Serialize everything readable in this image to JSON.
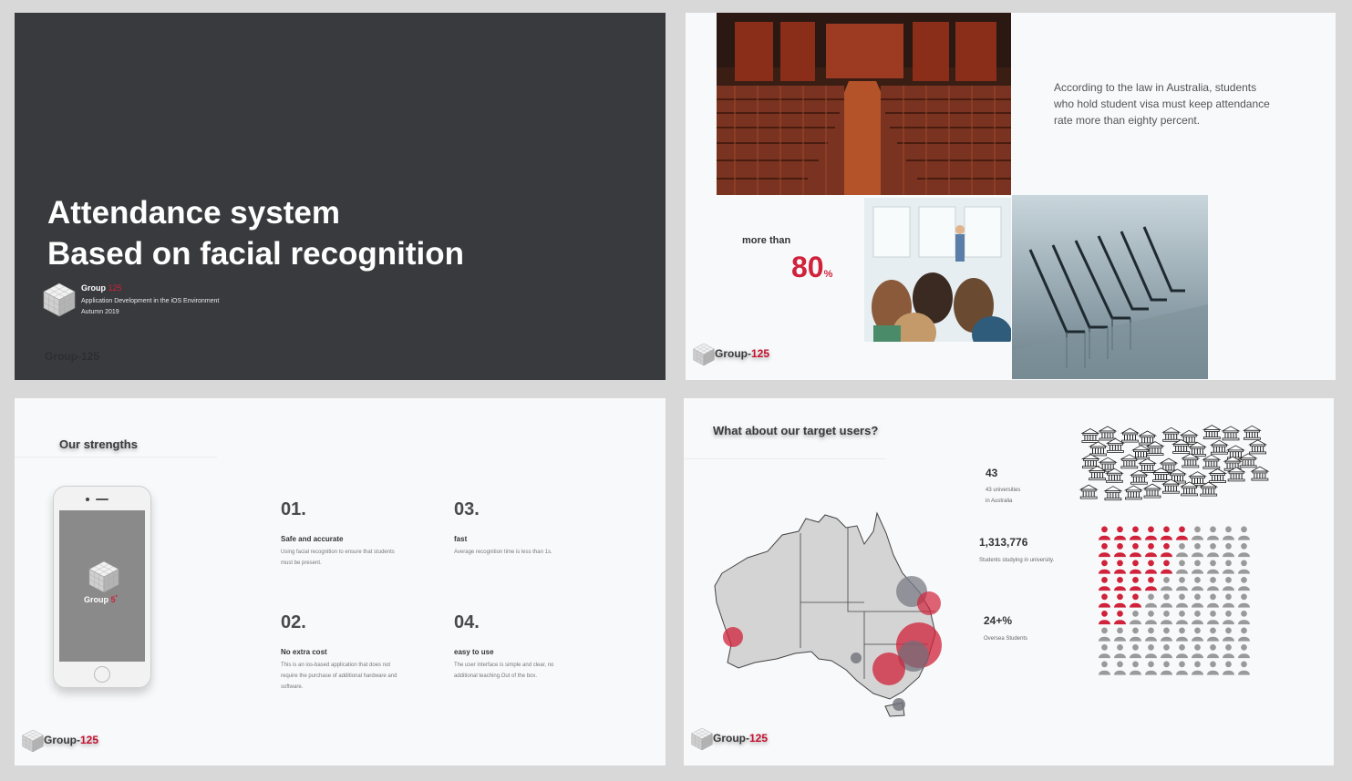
{
  "slide1": {
    "title_line1": "Attendance system",
    "title_line2": "Based on facial recognition",
    "group_label": "Group",
    "group_number": "125",
    "course": "Application Development in the iOS Environment",
    "term": "Autumn 2019",
    "footer": "Group-125"
  },
  "slide2": {
    "quote": "According to the law in Australia, students who hold student visa must keep attendance rate more than eighty percent.",
    "more_than": "more than",
    "percent_value": "80",
    "percent_sign": "%",
    "logo_prefix": "Group-",
    "logo_number": "125"
  },
  "slide3": {
    "heading": "Our strengths",
    "phone_group": "Group",
    "phone_num": "5",
    "phone_sup": "*",
    "strengths": [
      {
        "num": "01.",
        "title": "Safe and accurate",
        "desc": "Using facial recognition to ensure that students must be present."
      },
      {
        "num": "02.",
        "title": "No extra cost",
        "desc": "This is an ios-based application that does not require the purchase of additional hardware and software."
      },
      {
        "num": "03.",
        "title": "fast",
        "desc": "Average recognition time is less than 1s."
      },
      {
        "num": "04.",
        "title": "easy to use",
        "desc": "The user interface is simple and clear, no additional teaching.Out of the box."
      }
    ],
    "logo_prefix": "Group-",
    "logo_number": "125"
  },
  "slide4": {
    "heading": "What about our target users?",
    "stats": [
      {
        "value": "43",
        "label_line1": "43 universities",
        "label_line2": "in Australia"
      },
      {
        "value": "1,313,776",
        "label_line1": "Students studying in university.",
        "label_line2": ""
      },
      {
        "value": "24+%",
        "label_line1": "Oversea Students",
        "label_line2": ""
      }
    ],
    "people_grid": {
      "rows": 9,
      "cols": 10,
      "highlighted_per_row": [
        6,
        5,
        5,
        4,
        3,
        2,
        0,
        0,
        0
      ]
    },
    "university_count": 43,
    "logo_prefix": "Group-",
    "logo_number": "125"
  },
  "colors": {
    "accent_red": "#d0223a",
    "dark_slide": "#393a3e",
    "light_slide": "#f8f9fb"
  }
}
